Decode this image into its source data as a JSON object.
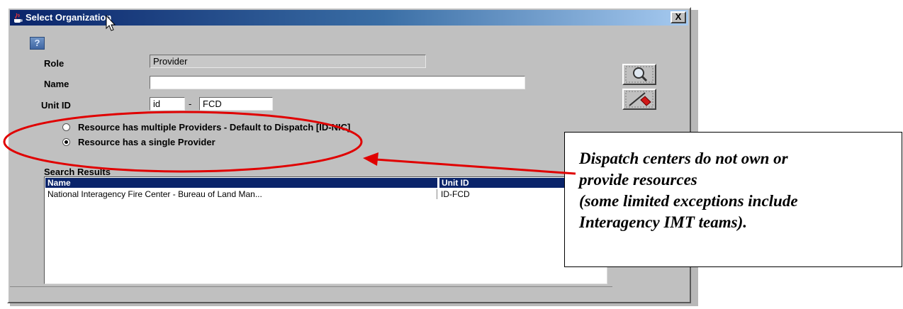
{
  "window": {
    "title": "Select Organization",
    "close_label": "X",
    "help_icon": "question-mark-icon"
  },
  "form": {
    "role_label": "Role",
    "role_value": "Provider",
    "name_label": "Name",
    "name_value": "",
    "unit_id_label": "Unit ID",
    "unit_id_prefix": "id",
    "unit_id_separator": "-",
    "unit_id_value": "FCD"
  },
  "toolbar": {
    "search_icon": "magnifier-icon",
    "clear_icon": "eraser-icon"
  },
  "options": [
    {
      "label": "Resource has multiple Providers - Default to Dispatch [ID-NIC]",
      "selected": false
    },
    {
      "label": "Resource has a single Provider",
      "selected": true
    }
  ],
  "results": {
    "label": "Search Results",
    "columns": [
      "Name",
      "Unit ID"
    ],
    "rows": [
      [
        "National Interagency Fire Center - Bureau of Land Man...",
        "ID-FCD"
      ]
    ]
  },
  "annotation": {
    "lines": [
      "Dispatch centers do not own or",
      "provide resources",
      "(some limited exceptions include",
      "Interagency IMT teams)."
    ],
    "color": "#e00000"
  }
}
